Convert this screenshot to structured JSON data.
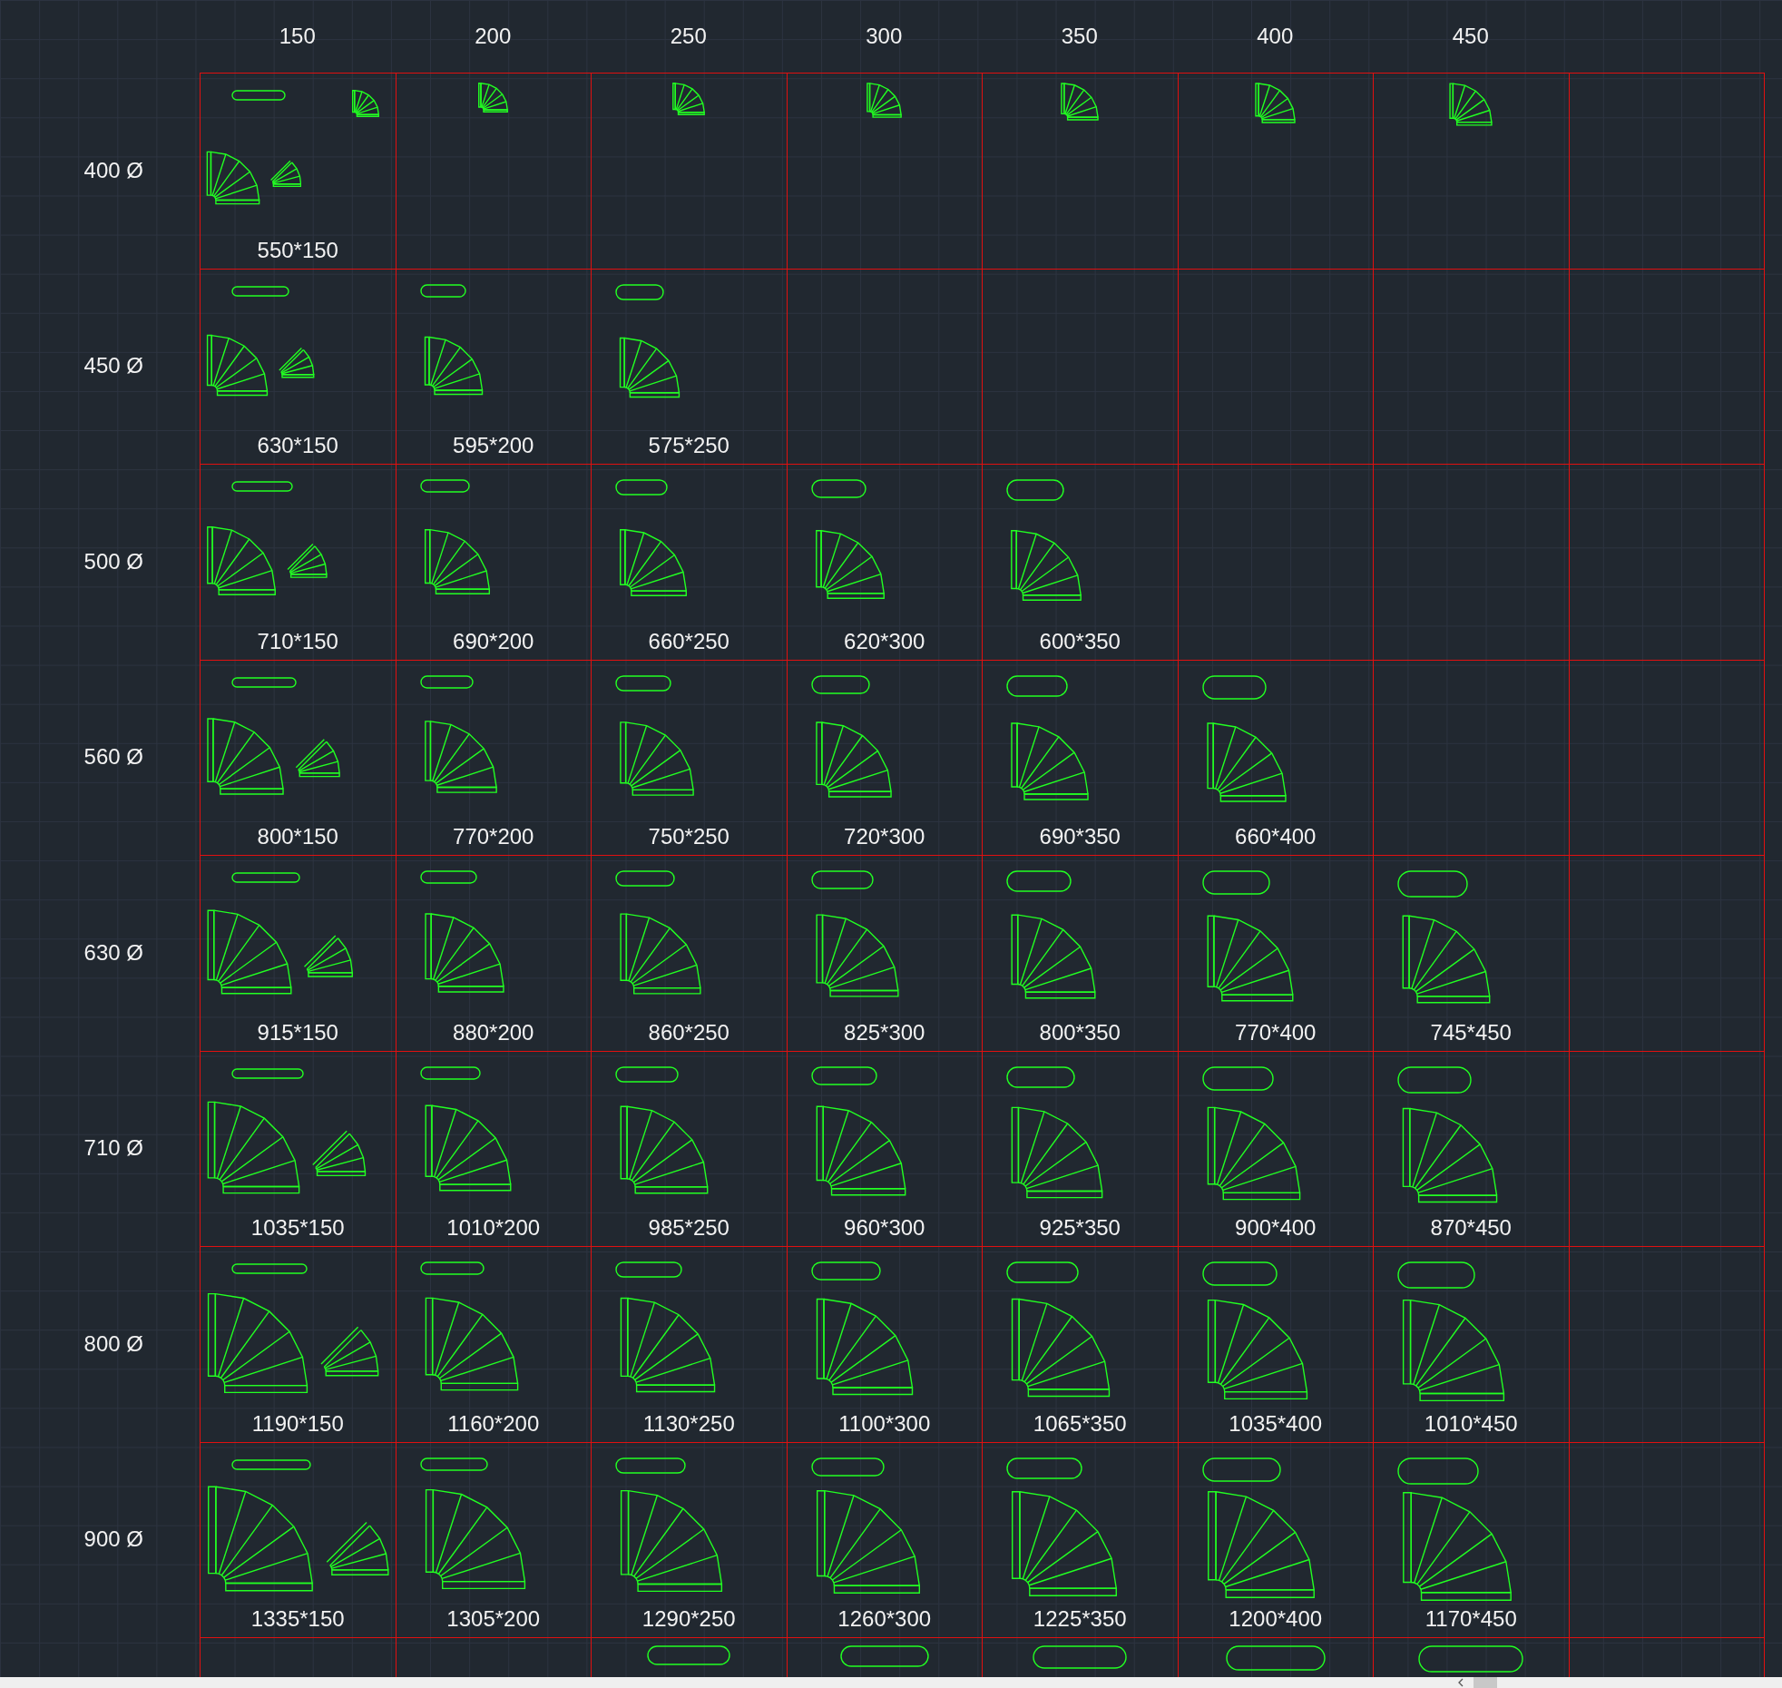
{
  "column_headers": [
    "150",
    "200",
    "250",
    "300",
    "350",
    "400",
    "450"
  ],
  "rows": [
    {
      "label": "400 Ø",
      "cells": [
        {
          "kind": "pair_small",
          "label": "550*150"
        },
        {
          "kind": "small"
        },
        {
          "kind": "small"
        },
        {
          "kind": "small"
        },
        {
          "kind": "small"
        },
        {
          "kind": "small"
        },
        {
          "kind": "small"
        },
        {
          "kind": "empty"
        }
      ]
    },
    {
      "label": "450 Ø",
      "cells": [
        {
          "kind": "pair",
          "label": "630*150"
        },
        {
          "kind": "single",
          "label": "595*200"
        },
        {
          "kind": "single",
          "label": "575*250"
        },
        {
          "kind": "empty"
        },
        {
          "kind": "empty"
        },
        {
          "kind": "empty"
        },
        {
          "kind": "empty"
        },
        {
          "kind": "empty"
        }
      ]
    },
    {
      "label": "500 Ø",
      "cells": [
        {
          "kind": "pair",
          "label": "710*150"
        },
        {
          "kind": "single",
          "label": "690*200"
        },
        {
          "kind": "single",
          "label": "660*250"
        },
        {
          "kind": "single",
          "label": "620*300"
        },
        {
          "kind": "single",
          "label": "600*350"
        },
        {
          "kind": "empty"
        },
        {
          "kind": "empty"
        },
        {
          "kind": "empty"
        }
      ]
    },
    {
      "label": "560 Ø",
      "cells": [
        {
          "kind": "pair",
          "label": "800*150"
        },
        {
          "kind": "single",
          "label": "770*200"
        },
        {
          "kind": "single",
          "label": "750*250"
        },
        {
          "kind": "single",
          "label": "720*300"
        },
        {
          "kind": "single",
          "label": "690*350"
        },
        {
          "kind": "single",
          "label": "660*400"
        },
        {
          "kind": "empty"
        },
        {
          "kind": "empty"
        }
      ]
    },
    {
      "label": "630 Ø",
      "cells": [
        {
          "kind": "pair",
          "label": "915*150"
        },
        {
          "kind": "single",
          "label": "880*200"
        },
        {
          "kind": "single",
          "label": "860*250"
        },
        {
          "kind": "single",
          "label": "825*300"
        },
        {
          "kind": "single",
          "label": "800*350"
        },
        {
          "kind": "single",
          "label": "770*400"
        },
        {
          "kind": "single",
          "label": "745*450"
        },
        {
          "kind": "empty"
        }
      ]
    },
    {
      "label": "710 Ø",
      "cells": [
        {
          "kind": "pair",
          "label": "1035*150"
        },
        {
          "kind": "single",
          "label": "1010*200"
        },
        {
          "kind": "single",
          "label": "985*250"
        },
        {
          "kind": "single",
          "label": "960*300"
        },
        {
          "kind": "single",
          "label": "925*350"
        },
        {
          "kind": "single",
          "label": "900*400"
        },
        {
          "kind": "single",
          "label": "870*450"
        },
        {
          "kind": "empty"
        }
      ]
    },
    {
      "label": "800 Ø",
      "cells": [
        {
          "kind": "pair",
          "label": "1190*150"
        },
        {
          "kind": "single",
          "label": "1160*200"
        },
        {
          "kind": "single",
          "label": "1130*250"
        },
        {
          "kind": "single",
          "label": "1100*300"
        },
        {
          "kind": "single",
          "label": "1065*350"
        },
        {
          "kind": "single",
          "label": "1035*400"
        },
        {
          "kind": "single",
          "label": "1010*450"
        },
        {
          "kind": "empty"
        }
      ]
    },
    {
      "label": "900 Ø",
      "cells": [
        {
          "kind": "pair",
          "label": "1335*150"
        },
        {
          "kind": "single",
          "label": "1305*200"
        },
        {
          "kind": "single",
          "label": "1290*250"
        },
        {
          "kind": "single",
          "label": "1260*300"
        },
        {
          "kind": "single",
          "label": "1225*350"
        },
        {
          "kind": "single",
          "label": "1200*400"
        },
        {
          "kind": "single",
          "label": "1170*450"
        },
        {
          "kind": "empty"
        }
      ]
    }
  ],
  "partial_row": {
    "cells": [
      {
        "kind": "empty"
      },
      {
        "kind": "empty"
      },
      {
        "kind": "oval"
      },
      {
        "kind": "oval"
      },
      {
        "kind": "oval"
      },
      {
        "kind": "oval"
      },
      {
        "kind": "oval"
      },
      {
        "kind": "empty"
      }
    ]
  }
}
